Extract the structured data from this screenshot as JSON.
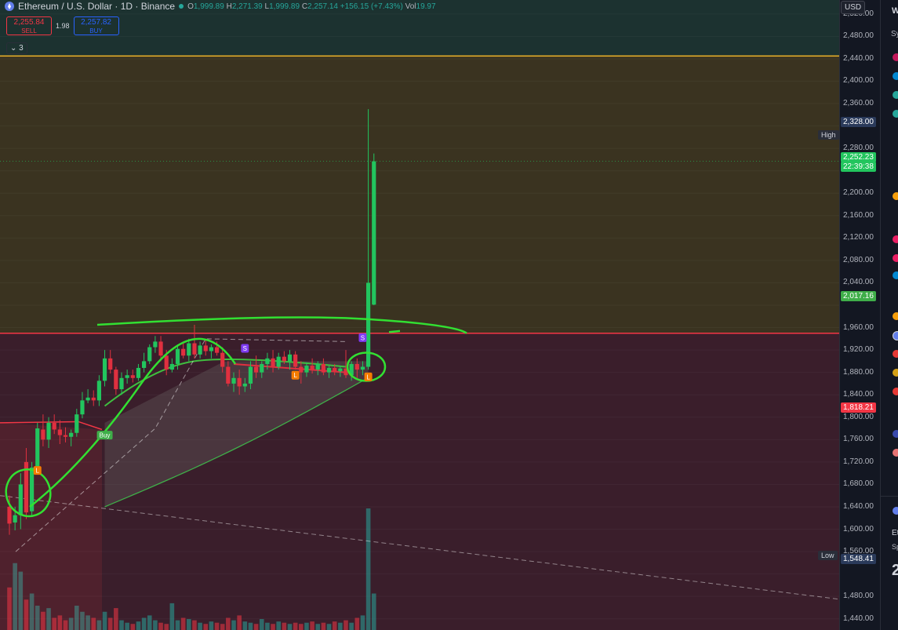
{
  "symbol": {
    "title": "Ethereum / U.S. Dollar · 1D · Binance",
    "ohlc": {
      "o_label": "O",
      "o": "1,999.89",
      "h_label": "H",
      "h": "2,271.39",
      "l_label": "L",
      "l": "1,999.89",
      "c_label": "C",
      "c": "2,257.14",
      "change": "+156.15 (+7.43%)",
      "vol_label": "Vol",
      "vol": "19.97"
    }
  },
  "trade": {
    "sell_price": "2,255.84",
    "sell_label": "SELL",
    "spread": "1.98",
    "buy_price": "2,257.82",
    "buy_label": "BUY"
  },
  "indicators_toggle": "3",
  "currency": "USD",
  "axis": {
    "ticks": [
      "2,520.00",
      "2,480.00",
      "2,440.00",
      "2,400.00",
      "2,360.00",
      "2,280.00",
      "2,200.00",
      "2,160.00",
      "2,120.00",
      "2,080.00",
      "2,040.00",
      "1,960.00",
      "1,920.00",
      "1,880.00",
      "1,840.00",
      "1,800.00",
      "1,760.00",
      "1,720.00",
      "1,680.00",
      "1,640.00",
      "1,600.00",
      "1,560.00",
      "1,480.00",
      "1,440.00"
    ],
    "high_label": "High",
    "high_value": "2,328.00",
    "low_label": "Low",
    "low_value": "1,548.41",
    "current_price": "2,252.23",
    "countdown": "22:39:38",
    "level_green": "2,017.16",
    "level_red": "1,818.21"
  },
  "colors": {
    "bull": "#22c55e",
    "bear": "#e0303f",
    "zone_upper": "#3a3320",
    "zone_lower": "#3a1e2b",
    "zone_top": "#1c3230",
    "drawing": "#32e032",
    "accent": "#2962ff"
  },
  "signals": {
    "buy_label": "Buy",
    "long_label": "L",
    "short_label": "S"
  },
  "right_panel": {
    "header": "W",
    "sub": "Sy",
    "ticker_fragment": "Et",
    "ticker_sub": "Sp",
    "price_fragment": "2"
  },
  "chart_data": {
    "type": "candlestick",
    "y_unit": "USD",
    "ylim": [
      1420,
      2545
    ],
    "levels": {
      "supply_top": 2445,
      "zone_boundary": 1950
    },
    "candles": [
      {
        "o": 1640,
        "h": 1660,
        "l": 1590,
        "c": 1610
      },
      {
        "o": 1612,
        "h": 1640,
        "l": 1598,
        "c": 1625
      },
      {
        "o": 1625,
        "h": 1700,
        "l": 1600,
        "c": 1680
      },
      {
        "o": 1720,
        "h": 1745,
        "l": 1618,
        "c": 1630
      },
      {
        "o": 1632,
        "h": 1720,
        "l": 1625,
        "c": 1710
      },
      {
        "o": 1708,
        "h": 1790,
        "l": 1700,
        "c": 1780
      },
      {
        "o": 1778,
        "h": 1805,
        "l": 1748,
        "c": 1760
      },
      {
        "o": 1760,
        "h": 1800,
        "l": 1745,
        "c": 1790
      },
      {
        "o": 1790,
        "h": 1805,
        "l": 1770,
        "c": 1778
      },
      {
        "o": 1778,
        "h": 1795,
        "l": 1752,
        "c": 1768
      },
      {
        "o": 1768,
        "h": 1782,
        "l": 1755,
        "c": 1765
      },
      {
        "o": 1765,
        "h": 1778,
        "l": 1748,
        "c": 1772
      },
      {
        "o": 1772,
        "h": 1815,
        "l": 1765,
        "c": 1805
      },
      {
        "o": 1805,
        "h": 1845,
        "l": 1798,
        "c": 1830
      },
      {
        "o": 1830,
        "h": 1850,
        "l": 1825,
        "c": 1835
      },
      {
        "o": 1835,
        "h": 1848,
        "l": 1820,
        "c": 1830
      },
      {
        "o": 1830,
        "h": 1875,
        "l": 1820,
        "c": 1865
      },
      {
        "o": 1865,
        "h": 1920,
        "l": 1855,
        "c": 1905
      },
      {
        "o": 1905,
        "h": 1920,
        "l": 1878,
        "c": 1885
      },
      {
        "o": 1885,
        "h": 1890,
        "l": 1840,
        "c": 1850
      },
      {
        "o": 1850,
        "h": 1880,
        "l": 1840,
        "c": 1870
      },
      {
        "o": 1870,
        "h": 1885,
        "l": 1860,
        "c": 1875
      },
      {
        "o": 1875,
        "h": 1885,
        "l": 1862,
        "c": 1870
      },
      {
        "o": 1870,
        "h": 1895,
        "l": 1865,
        "c": 1888
      },
      {
        "o": 1888,
        "h": 1915,
        "l": 1880,
        "c": 1900
      },
      {
        "o": 1900,
        "h": 1930,
        "l": 1895,
        "c": 1925
      },
      {
        "o": 1925,
        "h": 1945,
        "l": 1915,
        "c": 1935
      },
      {
        "o": 1935,
        "h": 1945,
        "l": 1900,
        "c": 1910
      },
      {
        "o": 1910,
        "h": 1920,
        "l": 1875,
        "c": 1885
      },
      {
        "o": 1885,
        "h": 1905,
        "l": 1880,
        "c": 1895
      },
      {
        "o": 1895,
        "h": 1930,
        "l": 1885,
        "c": 1922
      },
      {
        "o": 1922,
        "h": 1935,
        "l": 1905,
        "c": 1910
      },
      {
        "o": 1910,
        "h": 1940,
        "l": 1900,
        "c": 1932
      },
      {
        "o": 1932,
        "h": 1965,
        "l": 1905,
        "c": 1912
      },
      {
        "o": 1912,
        "h": 1935,
        "l": 1905,
        "c": 1928
      },
      {
        "o": 1928,
        "h": 1938,
        "l": 1910,
        "c": 1918
      },
      {
        "o": 1918,
        "h": 1930,
        "l": 1905,
        "c": 1925
      },
      {
        "o": 1925,
        "h": 1935,
        "l": 1910,
        "c": 1915
      },
      {
        "o": 1915,
        "h": 1925,
        "l": 1880,
        "c": 1890
      },
      {
        "o": 1890,
        "h": 1900,
        "l": 1855,
        "c": 1860
      },
      {
        "o": 1860,
        "h": 1880,
        "l": 1845,
        "c": 1870
      },
      {
        "o": 1870,
        "h": 1885,
        "l": 1840,
        "c": 1855
      },
      {
        "o": 1855,
        "h": 1870,
        "l": 1845,
        "c": 1860
      },
      {
        "o": 1860,
        "h": 1900,
        "l": 1850,
        "c": 1890
      },
      {
        "o": 1890,
        "h": 1910,
        "l": 1870,
        "c": 1880
      },
      {
        "o": 1880,
        "h": 1900,
        "l": 1870,
        "c": 1895
      },
      {
        "o": 1895,
        "h": 1915,
        "l": 1885,
        "c": 1905
      },
      {
        "o": 1905,
        "h": 1920,
        "l": 1880,
        "c": 1890
      },
      {
        "o": 1890,
        "h": 1915,
        "l": 1885,
        "c": 1908
      },
      {
        "o": 1908,
        "h": 1918,
        "l": 1895,
        "c": 1900
      },
      {
        "o": 1900,
        "h": 1920,
        "l": 1885,
        "c": 1912
      },
      {
        "o": 1912,
        "h": 1918,
        "l": 1885,
        "c": 1890
      },
      {
        "o": 1890,
        "h": 1900,
        "l": 1860,
        "c": 1880
      },
      {
        "o": 1880,
        "h": 1898,
        "l": 1872,
        "c": 1892
      },
      {
        "o": 1892,
        "h": 1905,
        "l": 1878,
        "c": 1885
      },
      {
        "o": 1885,
        "h": 1900,
        "l": 1875,
        "c": 1895
      },
      {
        "o": 1895,
        "h": 1905,
        "l": 1875,
        "c": 1880
      },
      {
        "o": 1880,
        "h": 1893,
        "l": 1870,
        "c": 1888
      },
      {
        "o": 1888,
        "h": 1895,
        "l": 1875,
        "c": 1882
      },
      {
        "o": 1882,
        "h": 1892,
        "l": 1872,
        "c": 1887
      },
      {
        "o": 1887,
        "h": 1920,
        "l": 1870,
        "c": 1875
      },
      {
        "o": 1875,
        "h": 1900,
        "l": 1865,
        "c": 1895
      },
      {
        "o": 1895,
        "h": 1905,
        "l": 1870,
        "c": 1885
      },
      {
        "o": 1885,
        "h": 1900,
        "l": 1875,
        "c": 1890
      },
      {
        "o": 1890,
        "h": 2350,
        "l": 1885,
        "c": 2040
      },
      {
        "o": 2001,
        "h": 2271,
        "l": 2000,
        "c": 2257
      }
    ],
    "volume": [
      0.35,
      0.55,
      0.48,
      0.25,
      0.3,
      0.2,
      0.15,
      0.18,
      0.1,
      0.12,
      0.08,
      0.1,
      0.2,
      0.15,
      0.12,
      0.1,
      0.08,
      0.15,
      0.1,
      0.18,
      0.08,
      0.06,
      0.05,
      0.07,
      0.1,
      0.12,
      0.08,
      0.06,
      0.05,
      0.22,
      0.08,
      0.1,
      0.09,
      0.08,
      0.06,
      0.05,
      0.07,
      0.06,
      0.05,
      0.1,
      0.08,
      0.12,
      0.07,
      0.06,
      0.05,
      0.09,
      0.06,
      0.05,
      0.07,
      0.06,
      0.05,
      0.06,
      0.05,
      0.06,
      0.07,
      0.05,
      0.06,
      0.05,
      0.07,
      0.06,
      0.08,
      0.06,
      0.1,
      0.12,
      1.0,
      0.3
    ]
  }
}
